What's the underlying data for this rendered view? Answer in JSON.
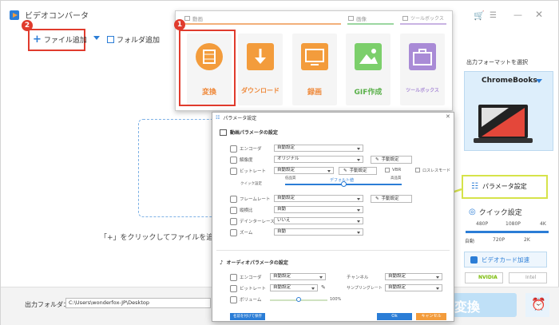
{
  "app": {
    "title": "ビデオコンバータ",
    "tabs": {
      "video": "動画",
      "image": "画像",
      "toolbox": "ツールボックス"
    }
  },
  "toolbar": {
    "add_file": "ファイル追加",
    "add_folder": "フォルダ追加"
  },
  "badges": {
    "one": "1",
    "two": "2"
  },
  "tools": {
    "convert": "変換",
    "download": "ダウンロード",
    "record": "録画",
    "gif": "GIF作成",
    "toolbox": "ツールボックス"
  },
  "main": {
    "hint": "「+」をクリックしてファイルを追加する"
  },
  "bottom": {
    "output_folder_label": "出力フォルダ：",
    "output_path": "C:\\Users\\wonderfox-JP\\Desktop",
    "convert_button": "変換"
  },
  "right": {
    "format_label": "出力フォーマットを選択",
    "format_value": "ChromeBooks",
    "param_button": "パラメータ設定",
    "quick_label": "クイック設定",
    "res": [
      "480P",
      "1080P",
      "4K"
    ],
    "res2": [
      "自動",
      "720P",
      "2K"
    ],
    "gpu_label": "ビデオカード加速",
    "nvidia": "NVIDIA",
    "intel": "Intel"
  },
  "dialog": {
    "title": "パラメータ設定",
    "video_section": "動画パラメータの設定",
    "video_rows": [
      {
        "label": "エンコーダ",
        "value": "自動設定"
      },
      {
        "label": "解像度",
        "value": "オリジナル"
      },
      {
        "label": "ビットレート",
        "value": "自動設定"
      },
      {
        "label": "フレームレート",
        "value": "自動設定"
      },
      {
        "label": "縦横比",
        "value": "自動"
      },
      {
        "label": "デインターレース",
        "value": "いいえ"
      },
      {
        "label": "ズーム",
        "value": "自動"
      }
    ],
    "manual": "手動設定",
    "vbr": "VBR",
    "lossless": "ロスレスモード",
    "quality_label": "クイック設定",
    "low": "低品質",
    "default": "デフォルト値",
    "high": "高品質",
    "audio_section": "オーディオパラメータの設定",
    "audio_rows": [
      {
        "label": "エンコーダ",
        "value": "自動設定"
      },
      {
        "label": "ビットレート",
        "value": "自動設定"
      },
      {
        "label": "ボリューム",
        "value": "100%"
      }
    ],
    "channel_label": "チャンネル",
    "channel_value": "自動設定",
    "sample_label": "サンプリングレート",
    "sample_value": "自動設定",
    "save_button": "名前を付けて保存",
    "ok_button": "Ok",
    "cancel_button": "キャンセル"
  },
  "colors": {
    "accent": "#f39c3c",
    "red": "#e03b2d",
    "blue": "#2b7dd6",
    "yellow_border": "#d6e34a",
    "arrow": "#d6e34a"
  }
}
